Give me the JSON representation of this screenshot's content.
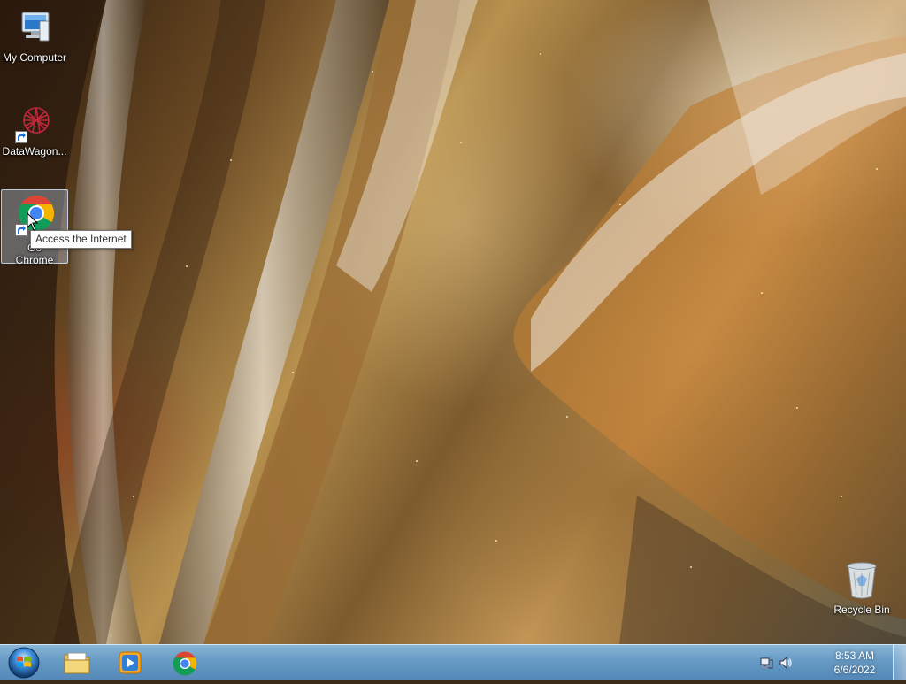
{
  "desktop": {
    "icons": [
      {
        "label": "My Computer",
        "icon": "computer-icon"
      },
      {
        "label": "DataWagon...",
        "icon": "datawagon-icon"
      },
      {
        "label": "Google Chrome",
        "icon": "chrome-icon",
        "label_line1": "Go",
        "label_line2": "Chrome"
      },
      {
        "label": "Recycle Bin",
        "icon": "recycle-bin-icon"
      }
    ],
    "tooltip": "Access the Internet"
  },
  "taskbar": {
    "start_icon": "windows-start-icon",
    "pinned": [
      {
        "name": "Windows Explorer",
        "icon": "folder-icon"
      },
      {
        "name": "Windows Media Player",
        "icon": "media-player-icon"
      },
      {
        "name": "Google Chrome",
        "icon": "chrome-icon"
      }
    ],
    "tray": {
      "network_icon": "network-icon",
      "volume_icon": "volume-icon",
      "time": "8:53 AM",
      "date": "6/6/2022"
    }
  },
  "colors": {
    "taskbar": "#7fb0d8",
    "selection": "#c8e1ff"
  }
}
